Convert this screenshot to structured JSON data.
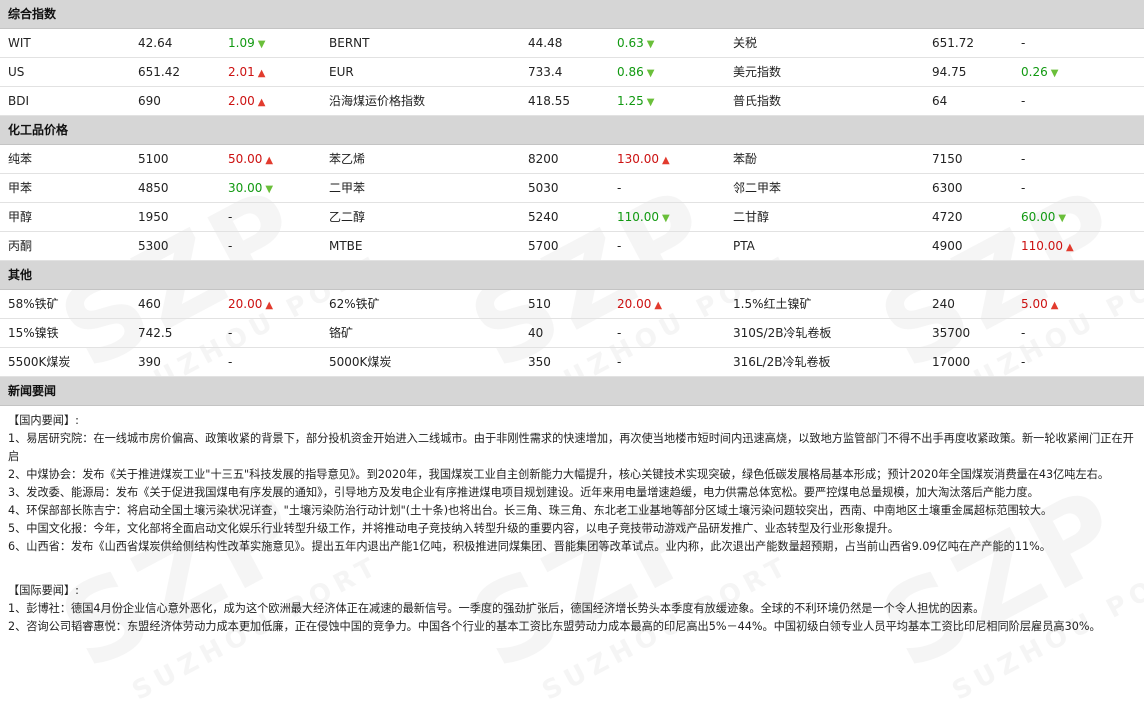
{
  "watermark": {
    "big": "SZP",
    "small": "SUZHOU PORT"
  },
  "sections": {
    "composite": {
      "title": "综合指数",
      "rows": [
        [
          {
            "n": "WIT",
            "v": "42.64",
            "c": "1.09",
            "d": "down"
          },
          {
            "n": "BERNT",
            "v": "44.48",
            "c": "0.63",
            "d": "down"
          },
          {
            "n": "关税",
            "v": "651.72",
            "c": "-",
            "d": ""
          }
        ],
        [
          {
            "n": "US",
            "v": "651.42",
            "c": "2.01",
            "d": "up"
          },
          {
            "n": "EUR",
            "v": "733.4",
            "c": "0.86",
            "d": "down"
          },
          {
            "n": "美元指数",
            "v": "94.75",
            "c": "0.26",
            "d": "down"
          }
        ],
        [
          {
            "n": "BDI",
            "v": "690",
            "c": "2.00",
            "d": "up"
          },
          {
            "n": "沿海煤运价格指数",
            "v": "418.55",
            "c": "1.25",
            "d": "down"
          },
          {
            "n": "普氏指数",
            "v": "64",
            "c": "-",
            "d": ""
          }
        ]
      ]
    },
    "chemical": {
      "title": "化工品价格",
      "rows": [
        [
          {
            "n": "纯苯",
            "v": "5100",
            "c": "50.00",
            "d": "up"
          },
          {
            "n": "苯乙烯",
            "v": "8200",
            "c": "130.00",
            "d": "up"
          },
          {
            "n": "苯酚",
            "v": "7150",
            "c": "-",
            "d": ""
          }
        ],
        [
          {
            "n": "甲苯",
            "v": "4850",
            "c": "30.00",
            "d": "down"
          },
          {
            "n": "二甲苯",
            "v": "5030",
            "c": "-",
            "d": ""
          },
          {
            "n": "邻二甲苯",
            "v": "6300",
            "c": "-",
            "d": ""
          }
        ],
        [
          {
            "n": "甲醇",
            "v": "1950",
            "c": "-",
            "d": ""
          },
          {
            "n": "乙二醇",
            "v": "5240",
            "c": "110.00",
            "d": "down"
          },
          {
            "n": "二甘醇",
            "v": "4720",
            "c": "60.00",
            "d": "down"
          }
        ],
        [
          {
            "n": "丙酮",
            "v": "5300",
            "c": "-",
            "d": ""
          },
          {
            "n": "MTBE",
            "v": "5700",
            "c": "-",
            "d": ""
          },
          {
            "n": "PTA",
            "v": "4900",
            "c": "110.00",
            "d": "up"
          }
        ]
      ]
    },
    "other": {
      "title": "其他",
      "rows": [
        [
          {
            "n": "58%铁矿",
            "v": "460",
            "c": "20.00",
            "d": "up"
          },
          {
            "n": "62%铁矿",
            "v": "510",
            "c": "20.00",
            "d": "up"
          },
          {
            "n": "1.5%红土镍矿",
            "v": "240",
            "c": "5.00",
            "d": "up"
          }
        ],
        [
          {
            "n": "15%镍铁",
            "v": "742.5",
            "c": "-",
            "d": ""
          },
          {
            "n": "铬矿",
            "v": "40",
            "c": "-",
            "d": ""
          },
          {
            "n": "310S/2B冷轧卷板",
            "v": "35700",
            "c": "-",
            "d": ""
          }
        ],
        [
          {
            "n": "5500K煤炭",
            "v": "390",
            "c": "-",
            "d": ""
          },
          {
            "n": "5000K煤炭",
            "v": "350",
            "c": "-",
            "d": ""
          },
          {
            "n": "316L/2B冷轧卷板",
            "v": "17000",
            "c": "-",
            "d": ""
          }
        ]
      ]
    }
  },
  "news": {
    "title": "新闻要闻",
    "domestic": {
      "heading": "【国内要闻】:",
      "items": [
        "1、易居研究院：在一线城市房价偏高、政策收紧的背景下，部分投机资金开始进入二线城市。由于非刚性需求的快速增加，再次使当地楼市短时间内迅速高烧，以致地方监管部门不得不出手再度收紧政策。新一轮收紧闸门正在开启",
        "2、中煤协会：发布《关于推进煤炭工业\"十三五\"科技发展的指导意见》。到2020年，我国煤炭工业自主创新能力大幅提升，核心关键技术实现突破，绿色低碳发展格局基本形成；预计2020年全国煤炭消费量在43亿吨左右。",
        "3、发改委、能源局：发布《关于促进我国煤电有序发展的通知》，引导地方及发电企业有序推进煤电项目规划建设。近年来用电量增速趋缓，电力供需总体宽松。要严控煤电总量规模，加大淘汰落后产能力度。",
        "4、环保部部长陈吉宁：将启动全国土壤污染状况详查，\"土壤污染防治行动计划\"(土十条)也将出台。长三角、珠三角、东北老工业基地等部分区域土壤污染问题较突出，西南、中南地区土壤重金属超标范围较大。",
        "5、中国文化报：今年，文化部将全面启动文化娱乐行业转型升级工作，并将推动电子竞技纳入转型升级的重要内容，以电子竞技带动游戏产品研发推广、业态转型及行业形象提升。",
        "6、山西省：发布《山西省煤炭供给侧结构性改革实施意见》。提出五年内退出产能1亿吨，积极推进同煤集团、晋能集团等改革试点。业内称，此次退出产能数量超预期，占当前山西省9.09亿吨在产产能的11%。"
      ]
    },
    "international": {
      "heading": "【国际要闻】:",
      "items": [
        "1、彭博社：德国4月份企业信心意外恶化，成为这个欧洲最大经济体正在减速的最新信号。一季度的强劲扩张后，德国经济增长势头本季度有放缓迹象。全球的不利环境仍然是一个令人担忧的因素。",
        "2、咨询公司韬睿惠悦：东盟经济体劳动力成本更加低廉，正在侵蚀中国的竞争力。中国各个行业的基本工资比东盟劳动力成本最高的印尼高出5%－44%。中国初级白领专业人员平均基本工资比印尼相同阶层雇员高30%。"
      ]
    }
  }
}
